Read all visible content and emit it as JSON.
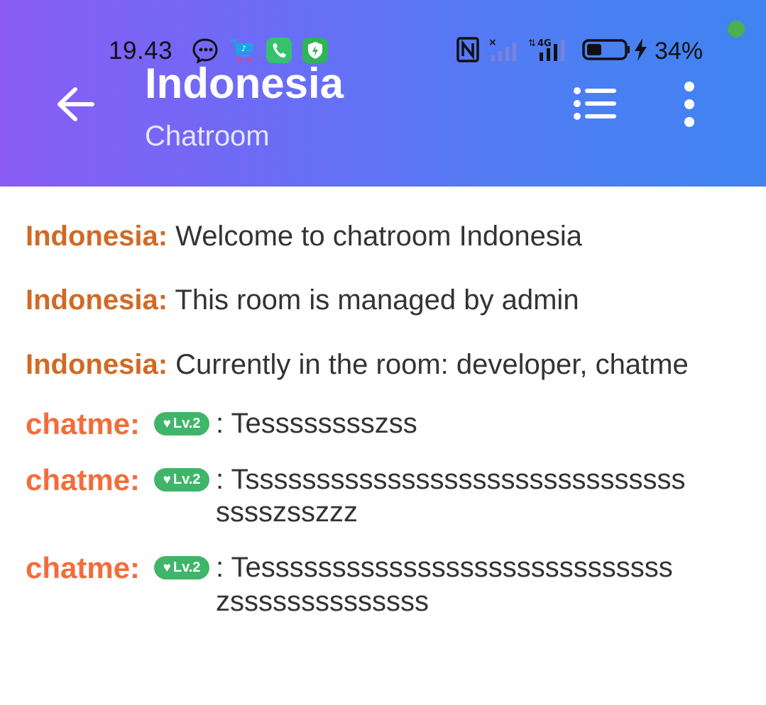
{
  "status_bar": {
    "time": "19.43",
    "battery": "34%"
  },
  "header": {
    "title": "Indonesia",
    "subtitle": "Chatroom"
  },
  "icons": {
    "back": "back-arrow-icon",
    "list": "list-icon",
    "more": "more-vertical-icon"
  },
  "room_messages": [
    {
      "sender": "Indonesia:",
      "text": "Welcome to chatroom Indonesia"
    },
    {
      "sender": "Indonesia:",
      "text": "This room is managed by admin"
    },
    {
      "sender": "Indonesia:",
      "text": "Currently in the room: developer, chatme"
    }
  ],
  "user_messages": [
    {
      "sender": "chatme:",
      "badge": "Lv.2",
      "lines": [
        ": Tesssssssszss"
      ]
    },
    {
      "sender": "chatme:",
      "badge": "Lv.2",
      "lines": [
        ": Tsssssssssssssssssssssssssssssss",
        "sssszsszzz"
      ]
    },
    {
      "sender": "chatme:",
      "badge": "Lv.2",
      "lines": [
        ": Tesssssssssssssssssssssssssssss",
        "zssssssssssssss"
      ]
    }
  ],
  "colors": {
    "room_sender": "#d06a25",
    "user_sender": "#f36c3c",
    "badge": "#3fb56a"
  }
}
